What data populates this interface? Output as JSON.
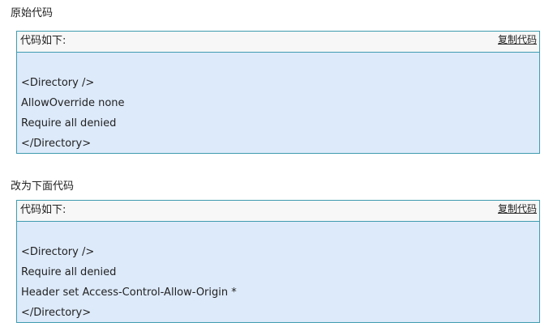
{
  "sections": [
    {
      "title": "原始代码",
      "header_label": "代码如下:",
      "copy_label": "复制代码",
      "lines": [
        "",
        "<Directory />",
        "AllowOverride none",
        "Require all denied",
        "</Directory>"
      ]
    },
    {
      "title": "改为下面代码",
      "header_label": "代码如下:",
      "copy_label": "复制代码",
      "lines": [
        "",
        "<Directory />",
        "Require all denied",
        "Header set Access-Control-Allow-Origin *",
        "</Directory>"
      ]
    }
  ]
}
